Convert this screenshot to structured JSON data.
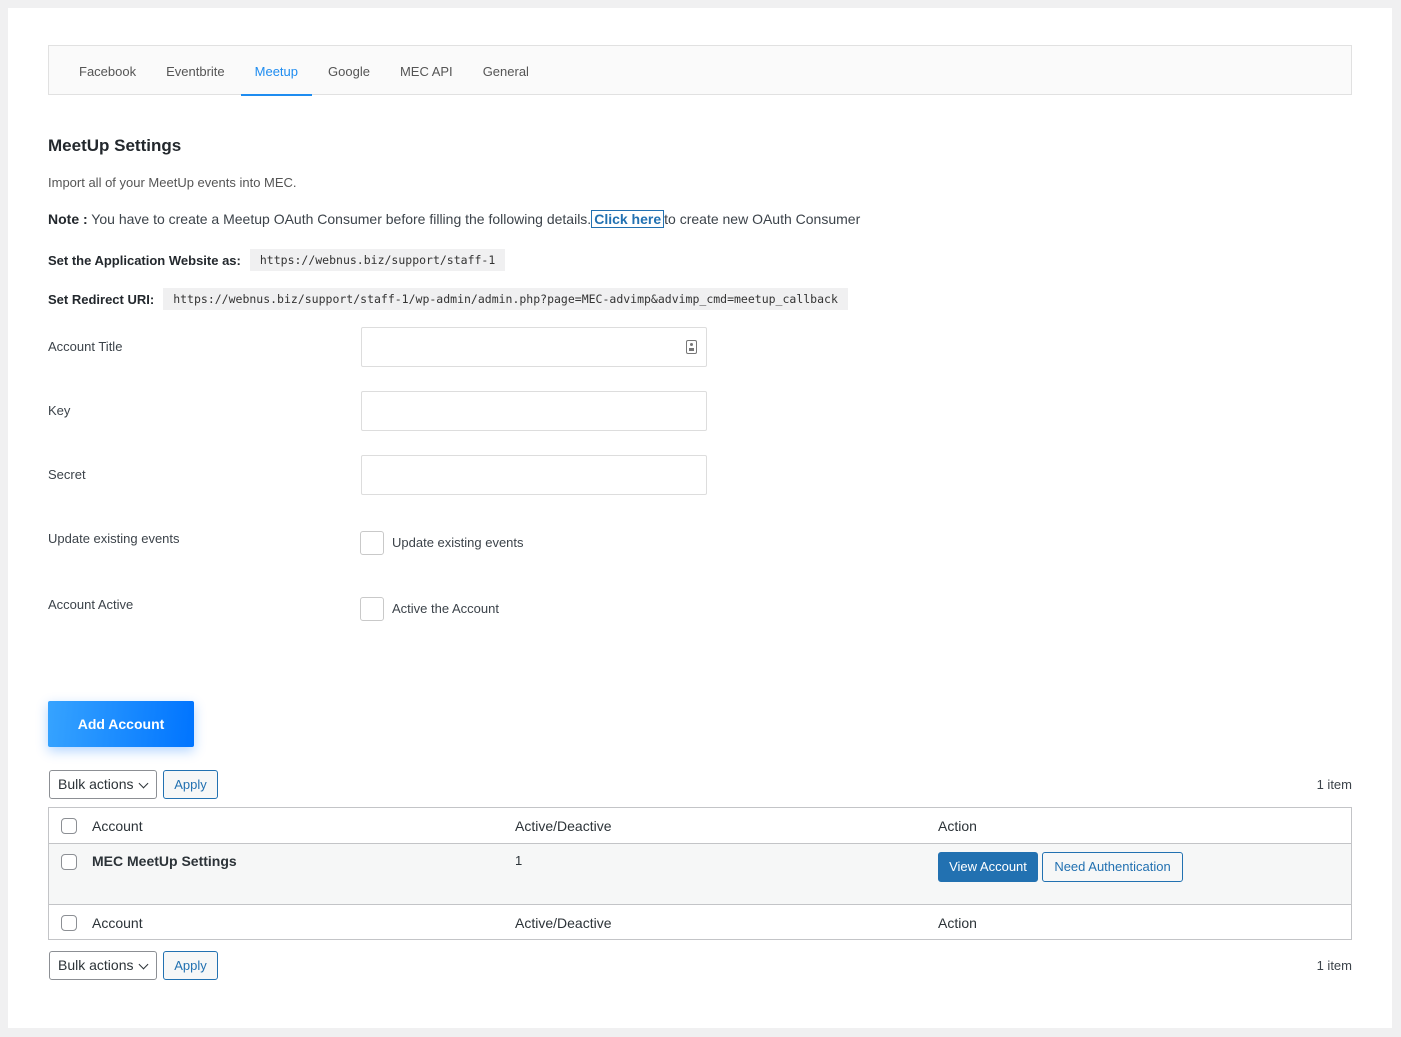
{
  "tabs": [
    "Facebook",
    "Eventbrite",
    "Meetup",
    "Google",
    "MEC API",
    "General"
  ],
  "active_tab": "Meetup",
  "heading": "MeetUp Settings",
  "description": "Import all of your MeetUp events into MEC.",
  "note": {
    "label": "Note :",
    "text": " You have to create a Meetup OAuth Consumer before filling the following details.",
    "link": "Click here",
    "after": "to create new OAuth Consumer"
  },
  "app_website": {
    "label": "Set the Application Website as:",
    "value": "https://webnus.biz/support/staff-1"
  },
  "redirect_uri": {
    "label": "Set Redirect URI:",
    "value": "https://webnus.biz/support/staff-1/wp-admin/admin.php?page=MEC-advimp&advimp_cmd=meetup_callback"
  },
  "fields": {
    "account_title": {
      "label": "Account Title",
      "value": "",
      "placeholder": ""
    },
    "key": {
      "label": "Key",
      "value": "",
      "placeholder": ""
    },
    "secret": {
      "label": "Secret",
      "value": "",
      "placeholder": ""
    },
    "update_existing": {
      "label": "Update existing events",
      "checkbox_label": "Update existing events",
      "checked": false
    },
    "account_active": {
      "label": "Account Active",
      "checkbox_label": "Active the Account",
      "checked": false
    }
  },
  "add_button": "Add Account",
  "bulk": {
    "select": "Bulk actions",
    "apply": "Apply",
    "count": "1 item"
  },
  "table": {
    "columns": [
      "Account",
      "Active/Deactive",
      "Action"
    ],
    "rows": [
      {
        "account": "MEC MeetUp Settings",
        "active": "1",
        "actions": [
          "View Account",
          "Need Authentication"
        ]
      }
    ]
  },
  "icons": {
    "field_icon": "contact-card-icon",
    "select_icon": "chevron-down-icon"
  },
  "colors": {
    "accent": "#1e8cf0",
    "primary_button": "#2271b1",
    "add_gradient_start": "#36a3ff",
    "add_gradient_end": "#0074ff"
  }
}
